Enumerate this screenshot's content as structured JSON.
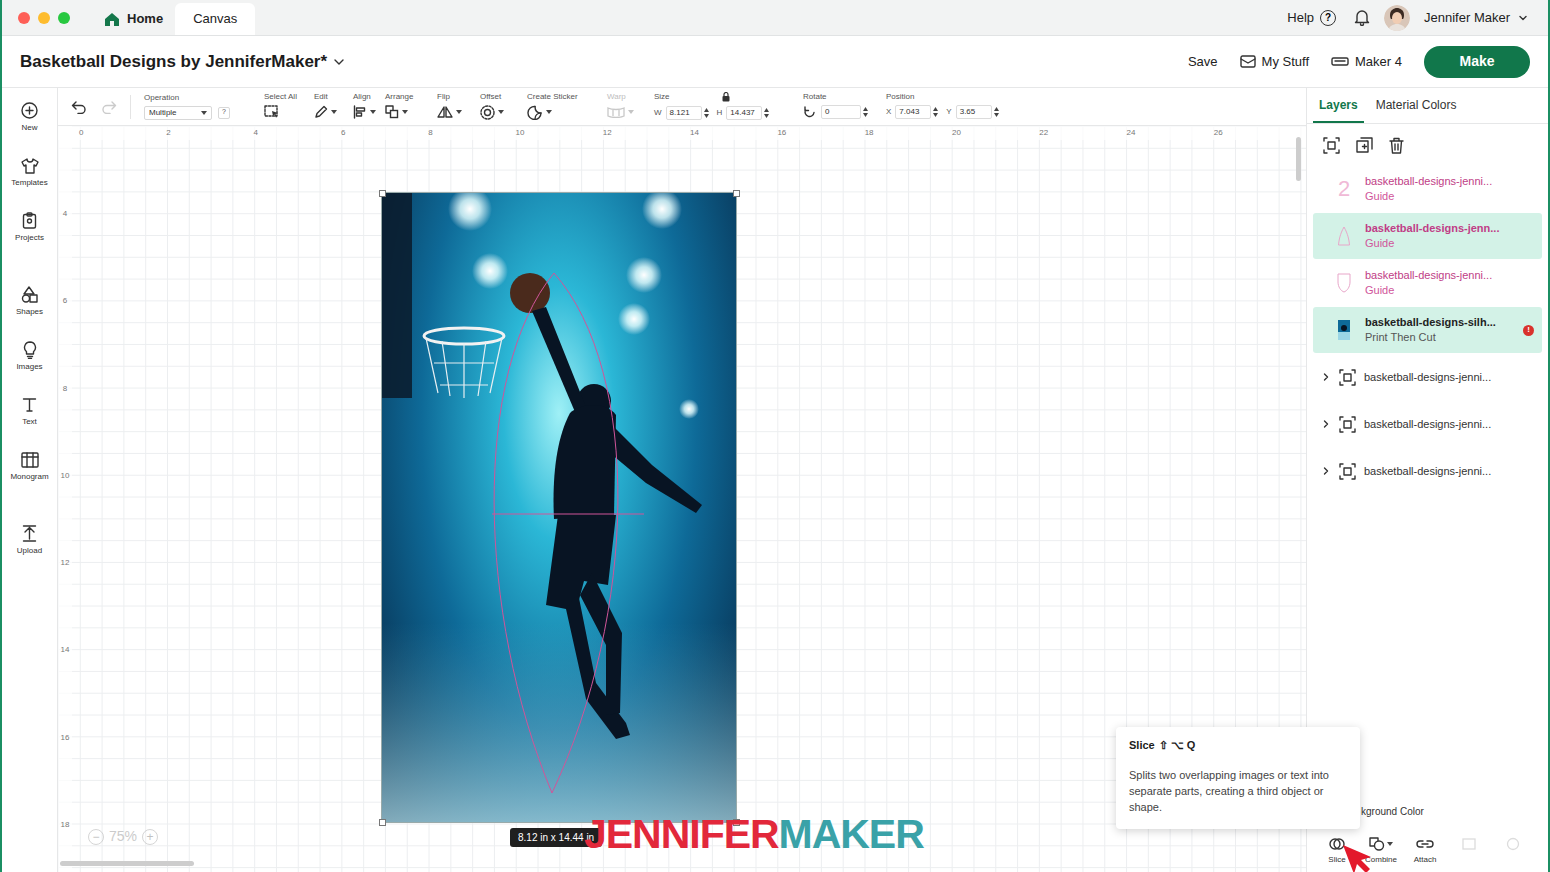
{
  "window": {
    "traffic_lights": [
      {
        "color": "#fe5f57"
      },
      {
        "color": "#febc2e"
      },
      {
        "color": "#28c840"
      }
    ]
  },
  "tabs": [
    {
      "label": "Home",
      "selected": false
    },
    {
      "label": "Canvas",
      "selected": true
    }
  ],
  "account": {
    "help": "Help",
    "help_icon": "?",
    "user": "Jennifer Maker"
  },
  "project": {
    "title": "Basketball Designs by JenniferMaker*"
  },
  "actions": {
    "save": "Save",
    "my_stuff": "My Stuff",
    "machine": "Maker 4",
    "make": "Make"
  },
  "toolbar": {
    "undo": {
      "disabled": false
    },
    "redo": {
      "disabled": true
    },
    "operation": {
      "label": "Operation",
      "value": "Multiple",
      "help": "?"
    },
    "tools": [
      {
        "label": "Select All",
        "disabled": false,
        "dropdown": false
      },
      {
        "label": "Edit",
        "disabled": false,
        "dropdown": true
      },
      {
        "label": "Align",
        "disabled": false,
        "dropdown": true
      },
      {
        "label": "Arrange",
        "disabled": false,
        "dropdown": true
      },
      {
        "label": "Flip",
        "disabled": false,
        "dropdown": true
      },
      {
        "label": "Offset",
        "disabled": false,
        "dropdown": true
      },
      {
        "label": "Create Sticker",
        "disabled": false,
        "dropdown": true
      },
      {
        "label": "Warp",
        "disabled": true,
        "dropdown": true
      }
    ],
    "size": {
      "label": "Size",
      "locked": true,
      "w_label": "W",
      "w": "8.121",
      "h_label": "H",
      "h": "14.437"
    },
    "rotate": {
      "label": "Rotate",
      "value": "0"
    },
    "position": {
      "label": "Position",
      "x_label": "X",
      "x": "7.043",
      "y_label": "Y",
      "y": "3.65"
    }
  },
  "sidebar": {
    "items": [
      "New",
      "Templates",
      "Projects",
      "Shapes",
      "Images",
      "Text",
      "Monogram",
      "Upload"
    ]
  },
  "canvas": {
    "ruler_top": [
      "0",
      "2",
      "4",
      "6",
      "8",
      "10",
      "12",
      "14",
      "16",
      "18",
      "20",
      "22",
      "24",
      "26"
    ],
    "ruler_left": [
      "4",
      "6",
      "8",
      "10",
      "12",
      "14",
      "16",
      "18"
    ],
    "selection_size": "8.12 in x 14.44 in",
    "zoom": {
      "minus": "−",
      "value": "75%",
      "plus": "+"
    }
  },
  "watermark": {
    "first": "JENNIFER",
    "second": "MAKER"
  },
  "panel": {
    "tabs": [
      {
        "label": "Layers",
        "selected": true
      },
      {
        "label": "Material Colors",
        "selected": false
      }
    ],
    "layers": [
      {
        "kind": "guide",
        "thumb": "2",
        "name": "basketball-designs-jenni...",
        "type": "Guide",
        "selected": false
      },
      {
        "kind": "guide",
        "name": "basketball-designs-jenn...",
        "type": "Guide",
        "selected": true
      },
      {
        "kind": "guide",
        "name": "basketball-designs-jenni...",
        "type": "Guide",
        "selected": false
      },
      {
        "kind": "print",
        "name": "basketball-designs-silh...",
        "type": "Print Then Cut",
        "selected": true,
        "warning": "!"
      },
      {
        "kind": "group",
        "name": "basketball-designs-jenni...",
        "selected": false,
        "expanded": false
      },
      {
        "kind": "group",
        "name": "basketball-designs-jenni...",
        "selected": false,
        "expanded": false
      },
      {
        "kind": "group",
        "name": "basketball-designs-jenni...",
        "selected": false,
        "expanded": false
      }
    ],
    "background_label": "kground Color",
    "buttons": [
      {
        "label": "Slice",
        "disabled": false,
        "dropdown": false
      },
      {
        "label": "Combine",
        "disabled": false,
        "dropdown": true
      },
      {
        "label": "Attach",
        "disabled": false,
        "dropdown": false
      },
      {
        "disabled": true
      },
      {
        "disabled": true
      }
    ]
  },
  "tooltip": {
    "title": "Slice",
    "shortcut": "⇧ ⌥ Q",
    "body": "Splits two overlapping images or text into separate parts, creating a third object or shape."
  }
}
